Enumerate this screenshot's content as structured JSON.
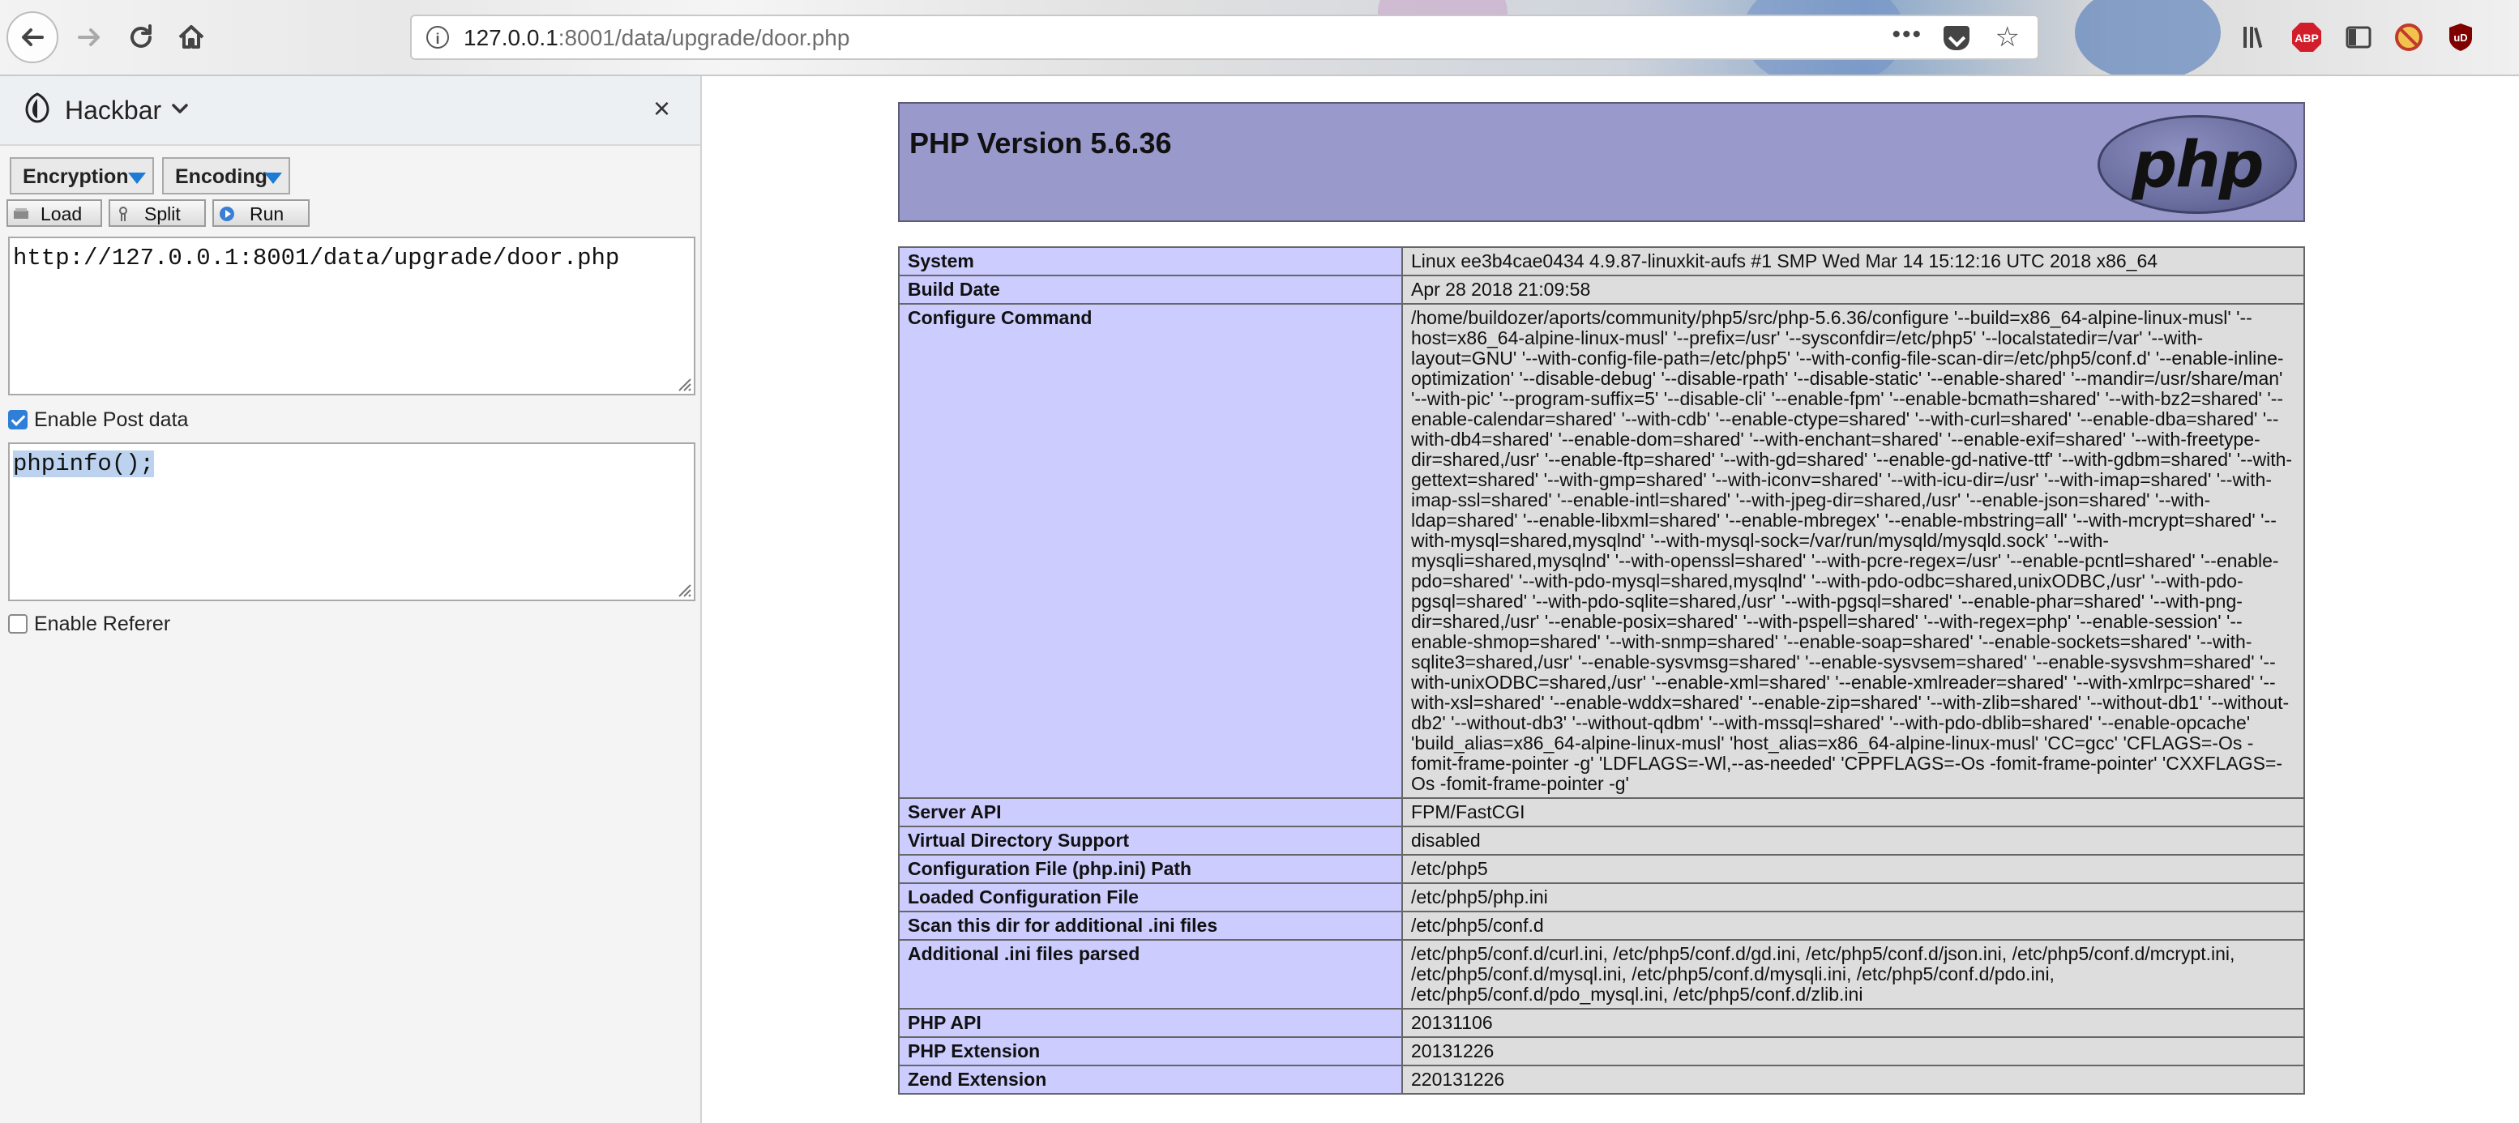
{
  "browser": {
    "url_host": "127.0.0.1",
    "url_rest": ":8001/data/upgrade/door.php",
    "url_more": "•••"
  },
  "hackbar": {
    "title": "Hackbar",
    "close": "×",
    "encryption_label": "Encryption",
    "encoding_label": "Encoding",
    "load_label": "Load",
    "split_label": "Split",
    "run_label": "Run",
    "url_value": "http://127.0.0.1:8001/data/upgrade/door.php",
    "enable_post_label": "Enable Post data",
    "enable_post_checked": true,
    "post_value": "phpinfo();",
    "enable_referer_label": "Enable Referer",
    "enable_referer_checked": false
  },
  "phpinfo": {
    "version_title": "PHP Version 5.6.36",
    "logo_text": "php",
    "rows": [
      {
        "key": "System",
        "value": "Linux ee3b4cae0434 4.9.87-linuxkit-aufs #1 SMP Wed Mar 14 15:12:16 UTC 2018 x86_64"
      },
      {
        "key": "Build Date",
        "value": "Apr 28 2018 21:09:58"
      },
      {
        "key": "Configure Command",
        "value": "/home/buildozer/aports/community/php5/src/php-5.6.36/configure '--build=x86_64-alpine-linux-musl' '--host=x86_64-alpine-linux-musl' '--prefix=/usr' '--sysconfdir=/etc/php5' '--localstatedir=/var' '--with-layout=GNU' '--with-config-file-path=/etc/php5' '--with-config-file-scan-dir=/etc/php5/conf.d' '--enable-inline-optimization' '--disable-debug' '--disable-rpath' '--disable-static' '--enable-shared' '--mandir=/usr/share/man' '--with-pic' '--program-suffix=5' '--disable-cli' '--enable-fpm' '--enable-bcmath=shared' '--with-bz2=shared' '--enable-calendar=shared' '--with-cdb' '--enable-ctype=shared' '--with-curl=shared' '--enable-dba=shared' '--with-db4=shared' '--enable-dom=shared' '--with-enchant=shared' '--enable-exif=shared' '--with-freetype-dir=shared,/usr' '--enable-ftp=shared' '--with-gd=shared' '--enable-gd-native-ttf' '--with-gdbm=shared' '--with-gettext=shared' '--with-gmp=shared' '--with-iconv=shared' '--with-icu-dir=/usr' '--with-imap=shared' '--with-imap-ssl=shared' '--enable-intl=shared' '--with-jpeg-dir=shared,/usr' '--enable-json=shared' '--with-ldap=shared' '--enable-libxml=shared' '--enable-mbregex' '--enable-mbstring=all' '--with-mcrypt=shared' '--with-mysql=shared,mysqlnd' '--with-mysql-sock=/var/run/mysqld/mysqld.sock' '--with-mysqli=shared,mysqlnd' '--with-openssl=shared' '--with-pcre-regex=/usr' '--enable-pcntl=shared' '--enable-pdo=shared' '--with-pdo-mysql=shared,mysqlnd' '--with-pdo-odbc=shared,unixODBC,/usr' '--with-pdo-pgsql=shared' '--with-pdo-sqlite=shared,/usr' '--with-pgsql=shared' '--enable-phar=shared' '--with-png-dir=shared,/usr' '--enable-posix=shared' '--with-pspell=shared' '--with-regex=php' '--enable-session' '--enable-shmop=shared' '--with-snmp=shared' '--enable-soap=shared' '--enable-sockets=shared' '--with-sqlite3=shared,/usr' '--enable-sysvmsg=shared' '--enable-sysvsem=shared' '--enable-sysvshm=shared' '--with-unixODBC=shared,/usr' '--enable-xml=shared' '--enable-xmlreader=shared' '--with-xmlrpc=shared' '--with-xsl=shared' '--enable-wddx=shared' '--enable-zip=shared' '--with-zlib=shared' '--without-db1' '--without-db2' '--without-db3' '--without-qdbm' '--with-mssql=shared' '--with-pdo-dblib=shared' '--enable-opcache' 'build_alias=x86_64-alpine-linux-musl' 'host_alias=x86_64-alpine-linux-musl' 'CC=gcc' 'CFLAGS=-Os -fomit-frame-pointer -g' 'LDFLAGS=-Wl,--as-needed' 'CPPFLAGS=-Os -fomit-frame-pointer' 'CXXFLAGS=-Os -fomit-frame-pointer -g'"
      },
      {
        "key": "Server API",
        "value": "FPM/FastCGI"
      },
      {
        "key": "Virtual Directory Support",
        "value": "disabled"
      },
      {
        "key": "Configuration File (php.ini) Path",
        "value": "/etc/php5"
      },
      {
        "key": "Loaded Configuration File",
        "value": "/etc/php5/php.ini"
      },
      {
        "key": "Scan this dir for additional .ini files",
        "value": "/etc/php5/conf.d"
      },
      {
        "key": "Additional .ini files parsed",
        "value": "/etc/php5/conf.d/curl.ini, /etc/php5/conf.d/gd.ini, /etc/php5/conf.d/json.ini, /etc/php5/conf.d/mcrypt.ini, /etc/php5/conf.d/mysql.ini, /etc/php5/conf.d/mysqli.ini, /etc/php5/conf.d/pdo.ini, /etc/php5/conf.d/pdo_mysql.ini, /etc/php5/conf.d/zlib.ini"
      },
      {
        "key": "PHP API",
        "value": "20131106"
      },
      {
        "key": "PHP Extension",
        "value": "20131226"
      },
      {
        "key": "Zend Extension",
        "value": "220131226"
      }
    ]
  },
  "icons": {
    "back": "back-arrow-icon",
    "forward": "forward-arrow-icon",
    "reload": "reload-icon",
    "home": "home-icon",
    "info": "info-icon",
    "pocket": "pocket-icon",
    "bookmark": "star-icon",
    "library": "library-icon",
    "adblock": "adblock-icon",
    "sidebar": "sidebar-icon",
    "noscript": "noscript-icon",
    "ublock": "ublock-icon"
  },
  "colors": {
    "php_header": "#9999cc",
    "php_key_cell": "#ccccff",
    "php_value_cell": "#dddddd",
    "accent": "#1c7bd4"
  }
}
